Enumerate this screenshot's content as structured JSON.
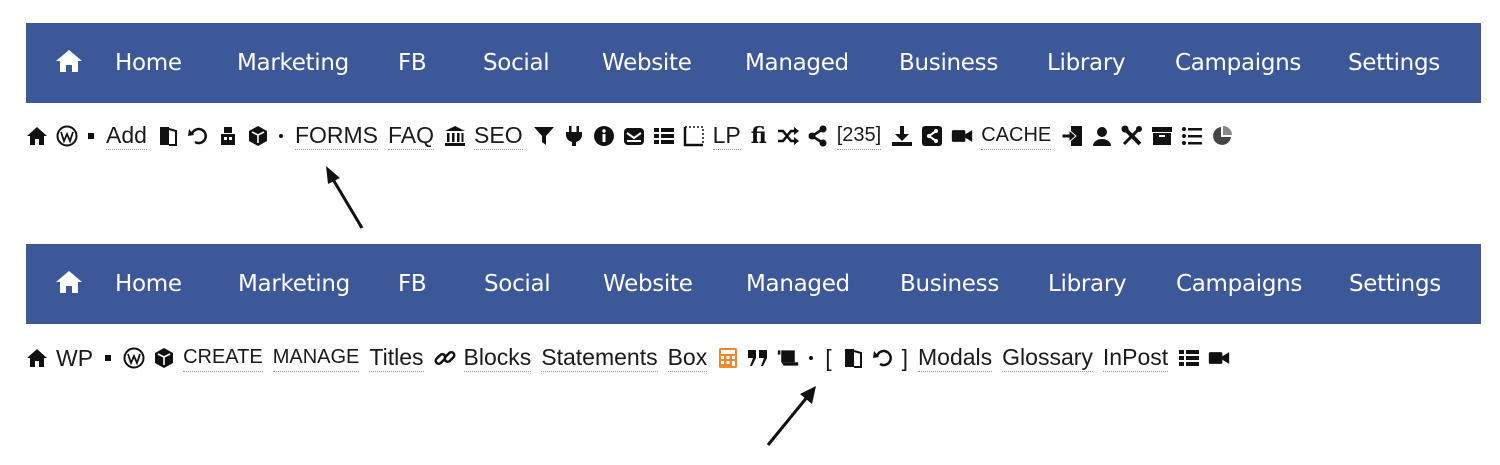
{
  "top_nav": {
    "items": [
      {
        "id": "home",
        "label": "Home"
      },
      {
        "id": "marketing",
        "label": "Marketing"
      },
      {
        "id": "fb",
        "label": "FB"
      },
      {
        "id": "social",
        "label": "Social"
      },
      {
        "id": "website",
        "label": "Website"
      },
      {
        "id": "managed",
        "label": "Managed"
      },
      {
        "id": "business",
        "label": "Business"
      },
      {
        "id": "library",
        "label": "Library"
      },
      {
        "id": "campaigns",
        "label": "Campaigns"
      },
      {
        "id": "settings",
        "label": "Settings"
      }
    ]
  },
  "bottom_nav": {
    "items": [
      {
        "id": "home",
        "label": "Home"
      },
      {
        "id": "marketing",
        "label": "Marketing"
      },
      {
        "id": "fb",
        "label": "FB"
      },
      {
        "id": "social",
        "label": "Social"
      },
      {
        "id": "website",
        "label": "Website"
      },
      {
        "id": "managed",
        "label": "Managed"
      },
      {
        "id": "business",
        "label": "Business"
      },
      {
        "id": "library",
        "label": "Library"
      },
      {
        "id": "campaigns",
        "label": "Campaigns"
      },
      {
        "id": "settings",
        "label": "Settings"
      }
    ]
  },
  "top_toolbar": {
    "add": "Add",
    "forms": "FORMS",
    "faq": "FAQ",
    "seo": "SEO",
    "lp": "LP",
    "fi": "fi",
    "count": "[235]",
    "cache": "CACHE"
  },
  "bottom_toolbar": {
    "wp": "WP",
    "create": "CREATE",
    "manage": "MANAGE",
    "titles": "Titles",
    "blocks": "Blocks",
    "statements": "Statements",
    "box": "Box",
    "bracket_open": "[",
    "bracket_close": "]",
    "modals": "Modals",
    "glossary": "Glossary",
    "inpost": "InPost"
  },
  "colors": {
    "nav_background": "#3c5898",
    "nav_text": "#ffffff",
    "highlight_icon": "#f0892e"
  },
  "icons": {
    "nav_home": "home-icon",
    "highlight": "calculator-icon"
  }
}
